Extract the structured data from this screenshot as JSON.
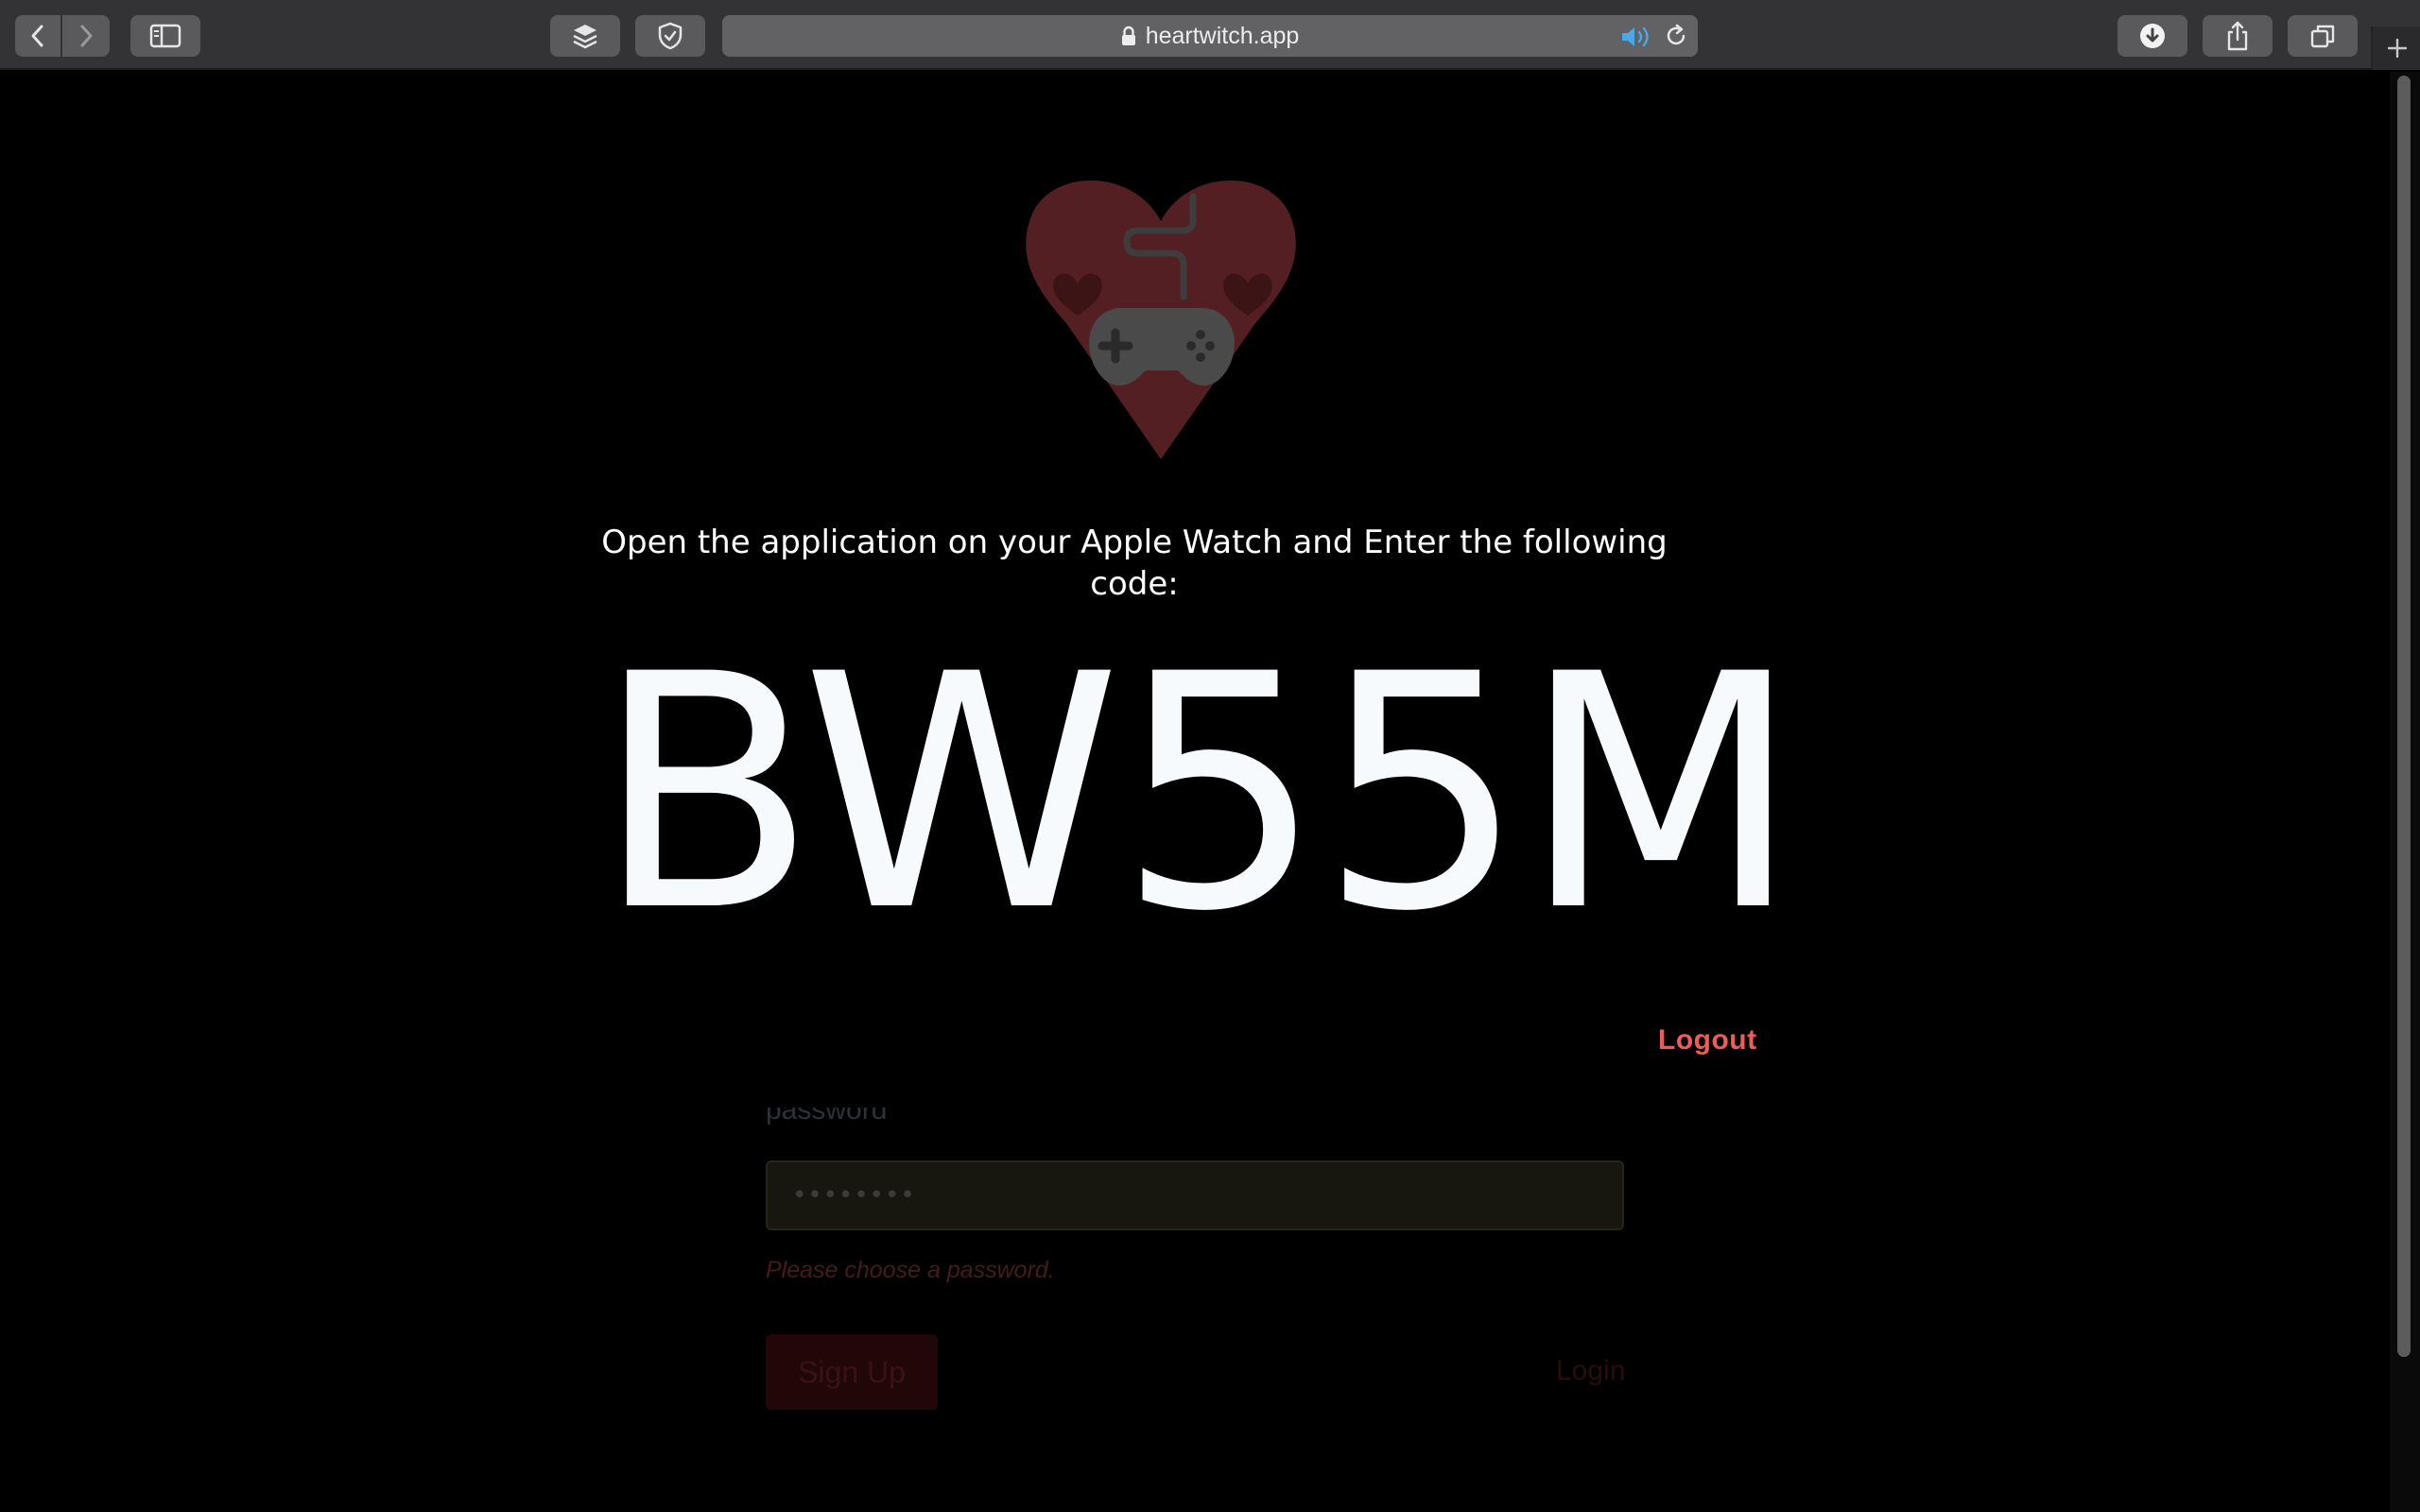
{
  "browser": {
    "url": "heartwitch.app",
    "icons": {
      "back": "chevron-left-icon",
      "forward": "chevron-right-icon",
      "sidebar": "sidebar-icon",
      "layers": "layers-icon",
      "shield": "shield-icon",
      "lock": "lock-icon",
      "audio": "speaker-icon",
      "reload": "reload-icon",
      "download": "download-icon",
      "share": "share-icon",
      "tabs": "tabs-icon",
      "new_tab": "plus-icon"
    }
  },
  "page": {
    "logo_icon": "heart-gamepad-logo",
    "instruction": "Open the application on your Apple Watch and Enter the following code:",
    "code": "BW55M",
    "logout_label": "Logout"
  },
  "background_form": {
    "password_label": "password",
    "password_value": "••••••••",
    "password_error": "Please choose a password.",
    "signup_label": "Sign Up",
    "login_label": "Login"
  },
  "colors": {
    "accent": "#ef5b57",
    "heart": "#531f22",
    "code_text": "#f7fafc"
  }
}
